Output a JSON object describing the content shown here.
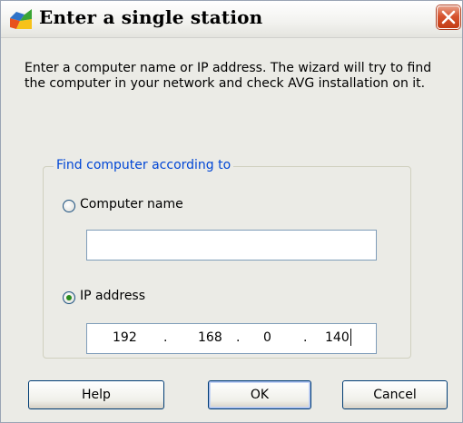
{
  "window": {
    "title": "Enter a single station"
  },
  "description": "Enter a computer name or IP address. The wizard will try to find the computer in your network and check AVG installation on it.",
  "group": {
    "legend": "Find computer according to",
    "computer_name": {
      "label": "Computer name",
      "selected": false,
      "value": ""
    },
    "ip_address": {
      "label": "IP address",
      "selected": true,
      "octets": [
        "192",
        "168",
        "0",
        "140"
      ],
      "separator": "."
    }
  },
  "buttons": {
    "help": "Help",
    "ok": "OK",
    "cancel": "Cancel"
  },
  "colors": {
    "dialog_background": "#ebebe6",
    "group_legend": "#0046d5",
    "close_button": "#d7542f",
    "radio_dot": "#2a8b1c"
  },
  "icons": {
    "app": "avg-logo-icon",
    "close": "close-icon"
  }
}
